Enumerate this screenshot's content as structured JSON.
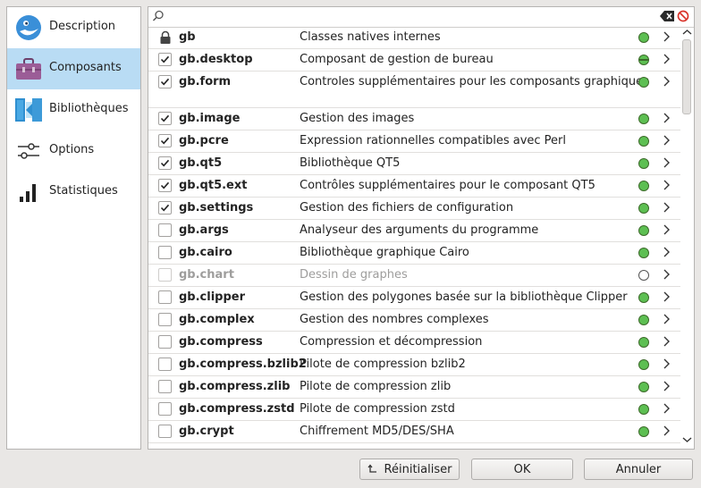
{
  "sidebar": {
    "items": [
      {
        "label": "Description",
        "icon": "gambas-logo-icon",
        "selected": false
      },
      {
        "label": "Composants",
        "icon": "toolbox-icon",
        "selected": true
      },
      {
        "label": "Bibliothèques",
        "icon": "library-icon",
        "selected": false
      },
      {
        "label": "Options",
        "icon": "sliders-icon",
        "selected": false
      },
      {
        "label": "Statistiques",
        "icon": "bar-chart-icon",
        "selected": false
      }
    ]
  },
  "search": {
    "value": "",
    "placeholder": ""
  },
  "components": {
    "rows": [
      {
        "name": "gb",
        "description": "Classes natives internes",
        "state": "locked",
        "status": "green"
      },
      {
        "name": "gb.desktop",
        "description": "Composant de gestion de bureau",
        "state": "checked",
        "status": "half"
      },
      {
        "name": "gb.form",
        "description": "Controles supplémentaires pour les composants graphiques",
        "state": "checked",
        "status": "green"
      },
      {
        "name": "gb.image",
        "description": "Gestion des images",
        "state": "checked",
        "status": "green"
      },
      {
        "name": "gb.pcre",
        "description": "Expression rationnelles compatibles avec Perl",
        "state": "checked",
        "status": "green"
      },
      {
        "name": "gb.qt5",
        "description": "Bibliothèque QT5",
        "state": "checked",
        "status": "green"
      },
      {
        "name": "gb.qt5.ext",
        "description": "Contrôles supplémentaires pour le composant QT5",
        "state": "checked",
        "status": "green"
      },
      {
        "name": "gb.settings",
        "description": "Gestion des fichiers de configuration",
        "state": "checked",
        "status": "green"
      },
      {
        "name": "gb.args",
        "description": "Analyseur des arguments du programme",
        "state": "unchecked",
        "status": "green"
      },
      {
        "name": "gb.cairo",
        "description": "Bibliothèque graphique Cairo",
        "state": "unchecked",
        "status": "green"
      },
      {
        "name": "gb.chart",
        "description": "Dessin de graphes",
        "state": "disabled",
        "status": "empty"
      },
      {
        "name": "gb.clipper",
        "description": "Gestion des polygones basée sur la bibliothèque Clipper",
        "state": "unchecked",
        "status": "green"
      },
      {
        "name": "gb.complex",
        "description": "Gestion des nombres complexes",
        "state": "unchecked",
        "status": "green"
      },
      {
        "name": "gb.compress",
        "description": "Compression et décompression",
        "state": "unchecked",
        "status": "green"
      },
      {
        "name": "gb.compress.bzlib2",
        "description": "Pilote de compression bzlib2",
        "state": "unchecked",
        "status": "green"
      },
      {
        "name": "gb.compress.zlib",
        "description": "Pilote de compression zlib",
        "state": "unchecked",
        "status": "green"
      },
      {
        "name": "gb.compress.zstd",
        "description": "Pilote de compression zstd",
        "state": "unchecked",
        "status": "green"
      },
      {
        "name": "gb.crypt",
        "description": "Chiffrement MD5/DES/SHA",
        "state": "unchecked",
        "status": "green"
      }
    ]
  },
  "buttons": {
    "reset": "Réinitialiser",
    "ok": "OK",
    "cancel": "Annuler"
  },
  "colors": {
    "selection": "#b9dcf4",
    "status_green": "#5dbf52",
    "cancel_red": "#d9352c"
  }
}
